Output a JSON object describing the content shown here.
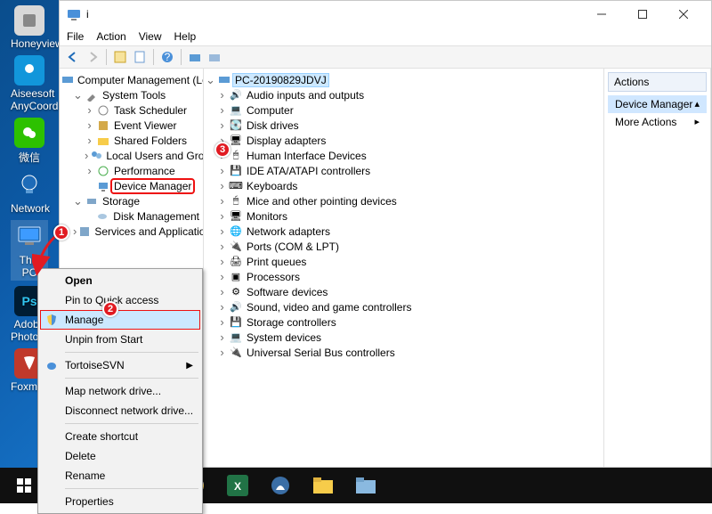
{
  "desktop": {
    "icons": [
      {
        "label": "Honeyview"
      },
      {
        "label": "Aiseesoft AnyCoord"
      },
      {
        "label": "微信"
      },
      {
        "label": "Network"
      },
      {
        "label": "This PC"
      },
      {
        "label": "Adobe Photosh..."
      },
      {
        "label": "Foxmai..."
      }
    ]
  },
  "window": {
    "title": "i",
    "menu": [
      "File",
      "Action",
      "View",
      "Help"
    ]
  },
  "tree_left": {
    "root": "Computer Management (Local)",
    "systools": "System Tools",
    "ts": "Task Scheduler",
    "ev": "Event Viewer",
    "sf": "Shared Folders",
    "lu": "Local Users and Groups",
    "pf": "Performance",
    "dm": "Device Manager",
    "storage": "Storage",
    "disk": "Disk Management",
    "sa": "Services and Applications"
  },
  "tree_right": {
    "root": "PC-20190829JDVJ",
    "items": [
      "Audio inputs and outputs",
      "Computer",
      "Disk drives",
      "Display adapters",
      "Human Interface Devices",
      "IDE ATA/ATAPI controllers",
      "Keyboards",
      "Mice and other pointing devices",
      "Monitors",
      "Network adapters",
      "Ports (COM & LPT)",
      "Print queues",
      "Processors",
      "Software devices",
      "Sound, video and game controllers",
      "Storage controllers",
      "System devices",
      "Universal Serial Bus controllers"
    ]
  },
  "actions": {
    "title": "Actions",
    "dm": "Device Manager",
    "more": "More Actions"
  },
  "ctx": {
    "open": "Open",
    "pin": "Pin to Quick access",
    "manage": "Manage",
    "unpin": "Unpin from Start",
    "tsvn": "TortoiseSVN",
    "map": "Map network drive...",
    "disc": "Disconnect network drive...",
    "sc": "Create shortcut",
    "del": "Delete",
    "ren": "Rename",
    "prop": "Properties"
  },
  "badges": {
    "b1": "1",
    "b2": "2",
    "b3": "3"
  }
}
